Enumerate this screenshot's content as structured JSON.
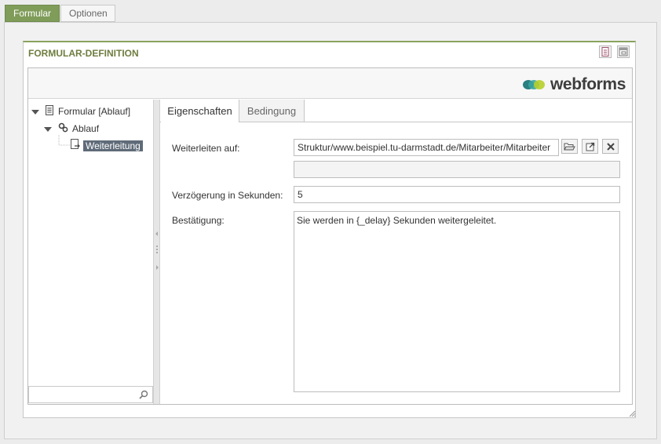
{
  "top_tabs": [
    {
      "label": "Formular",
      "active": true
    },
    {
      "label": "Optionen",
      "active": false
    }
  ],
  "panel": {
    "title": "FORMULAR-DEFINITION",
    "header_icons": [
      "document-icon",
      "window-icon"
    ]
  },
  "brand": {
    "name": "webforms"
  },
  "tree": {
    "items": [
      {
        "label": "Formular [Ablauf]",
        "icon": "form-icon",
        "expanded": true
      },
      {
        "label": "Ablauf",
        "icon": "gears-icon",
        "expanded": true
      },
      {
        "label": "Weiterleitung",
        "icon": "redirect-page-icon",
        "selected": true
      }
    ],
    "search_placeholder": ""
  },
  "tabs": [
    {
      "label": "Eigenschaften",
      "active": true
    },
    {
      "label": "Bedingung",
      "active": false
    }
  ],
  "form": {
    "redirect_label": "Weiterleiten auf:",
    "redirect_value": "Struktur/www.beispiel.tu-darmstadt.de/Mitarbeiter/Mitarbeiter",
    "redirect_extra": "",
    "delay_label": "Verzögerung in Sekunden:",
    "delay_value": "5",
    "confirm_label": "Bestätigung:",
    "confirm_value": "Sie werden in {_delay} Sekunden weitergeleitet."
  },
  "colors": {
    "accent_green": "#7f9c59",
    "title_green": "#6e7d3f",
    "selection": "#5f6b78"
  }
}
